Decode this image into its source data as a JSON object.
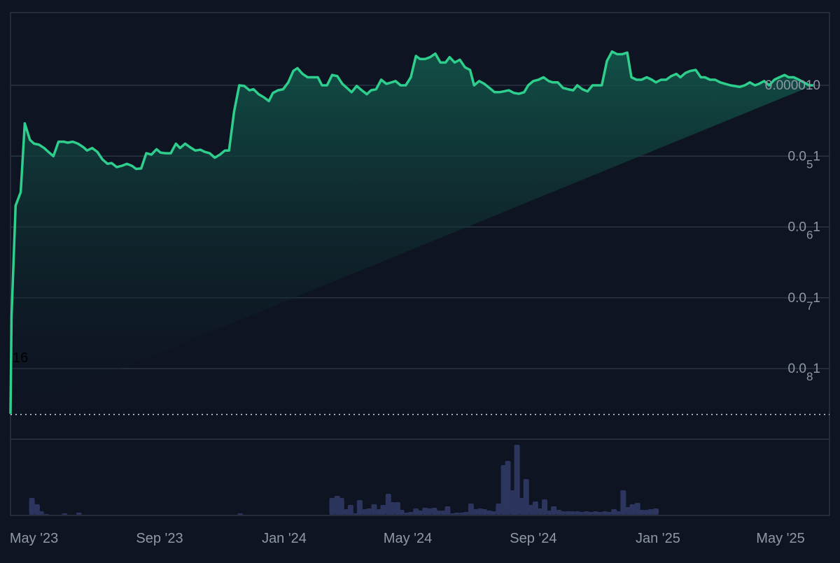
{
  "chart_data": {
    "type": "area",
    "colors": {
      "background": "#0e1422",
      "line": "#2ecf8c",
      "area_top": "#12574a",
      "gridline": "#2a3443",
      "tick_label": "#8f98a6",
      "volume_bar": "#2c355d",
      "baseline_marker": "#d8dde4"
    },
    "grid": true,
    "y_scale": "log",
    "y_axis_position": "right",
    "y_ticks": [
      {
        "value": 1e-05,
        "base": "0.000010",
        "sub": ""
      },
      {
        "value": 1e-06,
        "base": "0.0",
        "sub": "5",
        "tail": "1"
      },
      {
        "value": 1e-07,
        "base": "0.0",
        "sub": "6",
        "tail": "1"
      },
      {
        "value": 1e-08,
        "base": "0.0",
        "sub": "7",
        "tail": "1"
      },
      {
        "value": 1e-09,
        "base": "0.0",
        "sub": "8",
        "tail": "1"
      }
    ],
    "ylim": [
      2e-10,
      6e-05
    ],
    "x_range": [
      "2023-04-08",
      "2025-06-18"
    ],
    "x_ticks": [
      {
        "date": "2023-05-01",
        "label": "May '23"
      },
      {
        "date": "2023-09-01",
        "label": "Sep '23"
      },
      {
        "date": "2024-01-01",
        "label": "Jan '24"
      },
      {
        "date": "2024-05-01",
        "label": "May '24"
      },
      {
        "date": "2024-09-01",
        "label": "Sep '24"
      },
      {
        "date": "2025-01-01",
        "label": "Jan '25"
      },
      {
        "date": "2025-05-01",
        "label": "May '25"
      }
    ],
    "baseline_label": "16",
    "baseline_value": 2.25e-10,
    "price_series": {
      "dates": [
        "2023-04-08",
        "2023-04-09",
        "2023-04-13",
        "2023-04-18",
        "2023-04-22",
        "2023-04-27",
        "2023-05-01",
        "2023-05-06",
        "2023-05-11",
        "2023-05-15",
        "2023-05-20",
        "2023-05-25",
        "2023-05-30",
        "2023-06-03",
        "2023-06-08",
        "2023-06-13",
        "2023-06-18",
        "2023-06-22",
        "2023-06-27",
        "2023-07-02",
        "2023-07-07",
        "2023-07-12",
        "2023-07-16",
        "2023-07-21",
        "2023-07-26",
        "2023-07-31",
        "2023-08-05",
        "2023-08-09",
        "2023-08-14",
        "2023-08-19",
        "2023-08-24",
        "2023-08-29",
        "2023-09-02",
        "2023-09-07",
        "2023-09-12",
        "2023-09-17",
        "2023-09-21",
        "2023-09-26",
        "2023-10-01",
        "2023-10-06",
        "2023-10-11",
        "2023-10-15",
        "2023-10-20",
        "2023-10-25",
        "2023-10-30",
        "2023-11-04",
        "2023-11-08",
        "2023-11-13",
        "2023-11-18",
        "2023-11-23",
        "2023-11-28",
        "2023-12-02",
        "2023-12-07",
        "2023-12-12",
        "2023-12-17",
        "2023-12-21",
        "2023-12-26",
        "2023-12-31",
        "2024-01-05",
        "2024-01-10",
        "2024-01-14",
        "2024-01-19",
        "2024-01-24",
        "2024-01-29",
        "2024-02-03",
        "2024-02-07",
        "2024-02-12",
        "2024-02-17",
        "2024-02-22",
        "2024-02-27",
        "2024-03-02",
        "2024-03-07",
        "2024-03-12",
        "2024-03-17",
        "2024-03-22",
        "2024-03-26",
        "2024-03-31",
        "2024-04-05",
        "2024-04-10",
        "2024-04-15",
        "2024-04-19",
        "2024-04-24",
        "2024-04-29",
        "2024-05-04",
        "2024-05-09",
        "2024-05-13",
        "2024-05-18",
        "2024-05-23",
        "2024-05-28",
        "2024-06-02",
        "2024-06-07",
        "2024-06-11",
        "2024-06-16",
        "2024-06-21",
        "2024-06-26",
        "2024-07-01",
        "2024-07-05",
        "2024-07-10",
        "2024-07-15",
        "2024-07-20",
        "2024-07-25",
        "2024-07-30",
        "2024-08-03",
        "2024-08-08",
        "2024-08-13",
        "2024-08-18",
        "2024-08-23",
        "2024-08-27",
        "2024-09-01",
        "2024-09-06",
        "2024-09-11",
        "2024-09-16",
        "2024-09-20",
        "2024-09-25",
        "2024-09-30",
        "2024-10-05",
        "2024-10-10",
        "2024-10-14",
        "2024-10-19",
        "2024-10-24",
        "2024-10-29",
        "2024-11-03",
        "2024-11-07",
        "2024-11-12",
        "2024-11-17",
        "2024-11-22",
        "2024-11-27",
        "2024-12-02",
        "2024-12-06",
        "2024-12-11",
        "2024-12-16",
        "2024-12-21",
        "2024-12-26",
        "2024-12-30",
        "2025-01-04",
        "2025-01-09",
        "2025-01-14",
        "2025-01-19",
        "2025-01-23",
        "2025-01-28",
        "2025-02-02",
        "2025-02-07",
        "2025-02-12",
        "2025-02-16",
        "2025-02-21",
        "2025-02-26",
        "2025-03-03",
        "2025-03-08",
        "2025-03-13",
        "2025-03-17",
        "2025-03-22",
        "2025-03-27",
        "2025-04-01",
        "2025-04-06",
        "2025-04-10",
        "2025-04-15",
        "2025-04-20",
        "2025-04-25",
        "2025-04-30",
        "2025-05-05",
        "2025-05-09",
        "2025-05-14",
        "2025-05-19",
        "2025-05-24",
        "2025-05-29",
        "2025-06-02",
        "2025-06-07",
        "2025-06-12",
        "2025-06-17"
      ],
      "values": [
        2.3e-10,
        5.5e-09,
        2e-07,
        3.1e-07,
        2.9e-06,
        1.7e-06,
        1.5e-06,
        1.45e-06,
        1.3e-06,
        1.15e-06,
        1e-06,
        1.6e-06,
        1.6e-06,
        1.55e-06,
        1.6e-06,
        1.5e-06,
        1.35e-06,
        1.2e-06,
        1.3e-06,
        1.15e-06,
        9e-07,
        7.8e-07,
        8e-07,
        7e-07,
        7.3e-07,
        7.8e-07,
        7.3e-07,
        6.6e-07,
        6.7e-07,
        1.1e-06,
        1.05e-06,
        1.25e-06,
        1.12e-06,
        1.1e-06,
        1.1e-06,
        1.5e-06,
        1.3e-06,
        1.5e-06,
        1.33e-06,
        1.2e-06,
        1.23e-06,
        1.15e-06,
        1.1e-06,
        9.5e-07,
        1.05e-06,
        1.2e-06,
        1.2e-06,
        4.3e-06,
        1e-05,
        9.8e-06,
        8.5e-06,
        8.8e-06,
        7.5e-06,
        6.8e-06,
        6e-06,
        7.8e-06,
        8.5e-06,
        8.8e-06,
        1.1e-05,
        1.6e-05,
        1.75e-05,
        1.45e-05,
        1.3e-05,
        1.3e-05,
        1.3e-05,
        1e-05,
        1e-05,
        1.4e-05,
        1.35e-05,
        1.05e-05,
        9.3e-06,
        8e-06,
        9.8e-06,
        8.5e-06,
        7.5e-06,
        8.5e-06,
        8.8e-06,
        1.2e-05,
        1.05e-05,
        1.1e-05,
        1.15e-05,
        1e-05,
        1e-05,
        1.3e-05,
        2.6e-05,
        2.35e-05,
        2.35e-05,
        2.5e-05,
        2.8e-05,
        2.1e-05,
        2.1e-05,
        2.5e-05,
        2.1e-05,
        2.3e-05,
        1.8e-05,
        1.65e-05,
        1e-05,
        1.15e-05,
        1.05e-05,
        9.2e-06,
        8e-06,
        8e-06,
        8.2e-06,
        8.5e-06,
        7.8e-06,
        7.6e-06,
        8e-06,
        1e-05,
        1.15e-05,
        1.2e-05,
        1.3e-05,
        1.15e-05,
        1.1e-05,
        1.1e-05,
        9.2e-06,
        8.8e-06,
        8.5e-06,
        1e-05,
        8.8e-06,
        8.2e-06,
        1e-05,
        1e-05,
        1e-05,
        2.2e-05,
        3e-05,
        2.75e-05,
        2.75e-05,
        2.9e-05,
        1.3e-05,
        1.2e-05,
        1.2e-05,
        1.3e-05,
        1.2e-05,
        1.1e-05,
        1.2e-05,
        1.2e-05,
        1.35e-05,
        1.45e-05,
        1.3e-05,
        1.5e-05,
        1.6e-05,
        1.65e-05,
        1.3e-05,
        1.3e-05,
        1.2e-05,
        1.2e-05,
        1.1e-05,
        1.05e-05,
        1e-05,
        9.8e-06,
        9.5e-06,
        1e-05,
        1.1e-05,
        1e-05,
        1.05e-05,
        1.15e-05,
        1e-05,
        1.2e-05,
        1.3e-05,
        1.4e-05,
        1.3e-05,
        1.3e-05,
        1.2e-05,
        1.1e-05,
        1e-05,
        1e-05
      ]
    },
    "volume_series": {
      "dates": [
        "2023-04-29",
        "2023-05-04",
        "2023-05-08",
        "2023-05-13",
        "2023-05-17",
        "2023-05-22",
        "2023-05-26",
        "2023-05-31",
        "2023-06-04",
        "2023-06-09",
        "2023-06-14",
        "2023-06-18",
        "2023-06-23",
        "2023-06-27",
        "2023-07-02",
        "2023-07-06",
        "2023-07-11",
        "2023-07-15",
        "2023-07-20",
        "2023-07-24",
        "2023-07-29",
        "2023-08-02",
        "2023-08-07",
        "2023-08-11",
        "2023-08-16",
        "2023-08-21",
        "2023-08-25",
        "2023-08-30",
        "2023-09-03",
        "2023-09-08",
        "2023-09-12",
        "2023-09-17",
        "2023-09-21",
        "2023-09-26",
        "2023-09-30",
        "2023-10-05",
        "2023-10-09",
        "2023-10-14",
        "2023-10-18",
        "2023-10-23",
        "2023-10-27",
        "2023-11-01",
        "2023-11-05",
        "2023-11-10",
        "2023-11-14",
        "2023-11-19",
        "2023-11-23",
        "2023-11-28",
        "2023-12-02",
        "2023-12-07",
        "2023-12-11",
        "2023-12-16",
        "2023-12-20",
        "2023-12-25",
        "2023-12-30",
        "2024-01-03",
        "2024-01-08",
        "2024-01-12",
        "2024-01-17",
        "2024-01-21",
        "2024-01-26",
        "2024-01-30",
        "2024-02-04",
        "2024-02-08",
        "2024-02-13",
        "2024-02-17",
        "2024-02-22",
        "2024-02-26",
        "2024-03-02",
        "2024-03-06",
        "2024-03-11",
        "2024-03-15",
        "2024-03-20",
        "2024-03-24",
        "2024-03-29",
        "2024-04-03",
        "2024-04-07",
        "2024-04-12",
        "2024-04-16",
        "2024-04-21",
        "2024-04-25",
        "2024-04-30",
        "2024-05-04",
        "2024-05-09",
        "2024-05-13",
        "2024-05-18",
        "2024-05-22",
        "2024-05-27",
        "2024-05-31",
        "2024-06-05",
        "2024-06-09",
        "2024-06-14",
        "2024-06-18",
        "2024-06-23",
        "2024-06-27",
        "2024-07-02",
        "2024-07-06",
        "2024-07-11",
        "2024-07-15",
        "2024-07-20",
        "2024-07-24",
        "2024-07-29",
        "2024-08-03",
        "2024-08-07",
        "2024-08-12",
        "2024-08-16",
        "2024-08-21",
        "2024-08-25",
        "2024-08-30",
        "2024-09-03",
        "2024-09-08",
        "2024-09-12",
        "2024-09-17",
        "2024-09-21",
        "2024-09-26",
        "2024-09-30",
        "2024-10-05",
        "2024-10-09",
        "2024-10-14",
        "2024-10-18",
        "2024-10-23",
        "2024-10-27",
        "2024-11-01",
        "2024-11-05",
        "2024-11-10",
        "2024-11-14",
        "2024-11-19",
        "2024-11-23",
        "2024-11-28",
        "2024-12-03",
        "2024-12-07",
        "2024-12-12",
        "2024-12-16",
        "2024-12-21",
        "2024-12-25",
        "2024-12-30",
        "2025-01-03",
        "2025-01-08",
        "2025-01-12",
        "2025-01-17",
        "2025-01-21",
        "2025-01-26",
        "2025-01-30",
        "2025-02-04",
        "2025-02-08",
        "2025-02-13",
        "2025-02-18",
        "2025-02-22",
        "2025-02-27",
        "2025-03-03",
        "2025-03-08",
        "2025-03-12",
        "2025-03-17",
        "2025-03-21",
        "2025-03-26",
        "2025-03-30",
        "2025-04-04",
        "2025-04-08",
        "2025-04-13",
        "2025-04-17",
        "2025-04-22",
        "2025-04-26",
        "2025-05-01",
        "2025-05-06",
        "2025-05-10",
        "2025-05-15",
        "2025-05-19",
        "2025-05-24",
        "2025-05-28",
        "2025-06-02",
        "2025-06-06",
        "2025-06-11",
        "2025-06-15"
      ],
      "relative_heights": [
        0.24,
        0.15,
        0.05,
        0.01,
        0,
        0,
        0,
        0.02,
        0,
        0,
        0.03,
        0,
        0,
        0,
        0,
        0,
        0,
        0,
        0,
        0,
        0,
        0,
        0,
        0,
        0,
        0,
        0,
        0,
        0,
        0,
        0,
        0,
        0,
        0,
        0,
        0,
        0,
        0,
        0,
        0,
        0,
        0,
        0,
        0,
        0,
        0.02,
        0,
        0,
        0,
        0,
        0,
        0,
        0,
        0,
        0,
        0,
        0,
        0,
        0,
        0,
        0,
        0,
        0,
        0,
        0,
        0.24,
        0.27,
        0.24,
        0.08,
        0.14,
        0.02,
        0.21,
        0.08,
        0.09,
        0.15,
        0.08,
        0.14,
        0.3,
        0.18,
        0.18,
        0.07,
        0.03,
        0.04,
        0.09,
        0.06,
        0.1,
        0.09,
        0.1,
        0.06,
        0.06,
        0.12,
        0.02,
        0.03,
        0.03,
        0.04,
        0.16,
        0.08,
        0.09,
        0.08,
        0.06,
        0.05,
        0.16,
        0.71,
        0.77,
        0.35,
        1.0,
        0.24,
        0.51,
        0.14,
        0.19,
        0.09,
        0.22,
        0.06,
        0.12,
        0.07,
        0.05,
        0.05,
        0.05,
        0.05,
        0.04,
        0.05,
        0.04,
        0.05,
        0.04,
        0.05,
        0.04,
        0.08,
        0.05,
        0.35,
        0.11,
        0.15,
        0.17,
        0.07,
        0.07,
        0.08,
        0.09
      ]
    }
  }
}
